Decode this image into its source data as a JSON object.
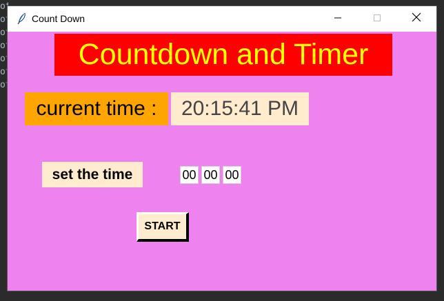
{
  "window": {
    "title": "Count Down",
    "icon": "feather-icon",
    "controls": [
      "minimize-icon",
      "maximize-icon",
      "close-icon"
    ]
  },
  "app": {
    "heading": "Countdown and Timer",
    "current_time_label": "current time :",
    "current_time_value": "20:15:41 PM",
    "set_time_label": "set the time",
    "hours": "00",
    "minutes": "00",
    "seconds": "00",
    "start_label": "START"
  },
  "colors": {
    "window_background": "#ee82ee",
    "heading_background": "#ff0000",
    "heading_text": "#ffff00",
    "current_label_background": "#ffa500",
    "value_background": "#ffebcd"
  }
}
